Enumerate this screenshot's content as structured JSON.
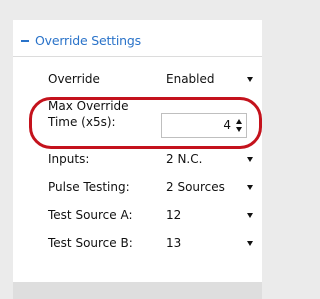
{
  "section": {
    "title": "Override Settings",
    "expanded": true
  },
  "settings": [
    {
      "label": "Override",
      "value": "Enabled",
      "control": "dropdown"
    },
    {
      "label": "Max Override Time (x5s):",
      "label_line1": "Max Override",
      "label_line2": "Time (x5s):",
      "value": "4",
      "control": "spinner"
    },
    {
      "label": "Inputs:",
      "value": "2 N.C.",
      "control": "dropdown"
    },
    {
      "label": "Pulse Testing:",
      "value": "2 Sources",
      "control": "dropdown"
    },
    {
      "label": "Test Source A:",
      "value": "12",
      "control": "dropdown"
    },
    {
      "label": "Test Source B:",
      "value": "13",
      "control": "dropdown"
    }
  ],
  "colors": {
    "header_accent": "#2a73c9",
    "highlight": "#c4121c",
    "panel_background": "#ffffff",
    "page_background": "#ebebeb"
  },
  "icons": [
    "collapse-icon",
    "dropdown-caret-icon",
    "spin-up-icon",
    "spin-down-icon"
  ]
}
